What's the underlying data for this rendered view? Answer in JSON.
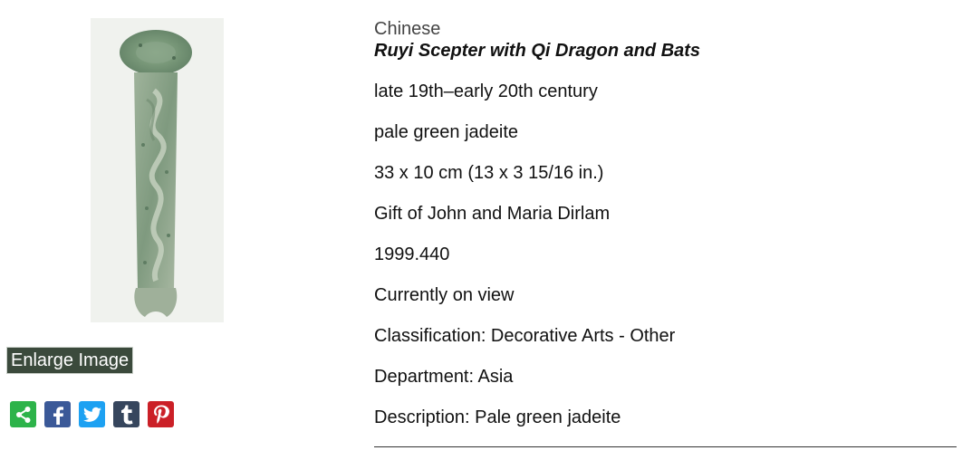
{
  "artwork": {
    "image_alt": "Ruyi Scepter with Qi Dragon and Bats",
    "culture": "Chinese",
    "title": "Ruyi Scepter with Qi Dragon and Bats",
    "date": "late 19th–early 20th century",
    "medium": "pale green jadeite",
    "dimensions": "33 x 10 cm (13 x 3 15/16 in.)",
    "credit": "Gift of John and Maria Dirlam",
    "accession": "1999.440",
    "status": "Currently on view",
    "classification": "Classification: Decorative Arts - Other",
    "department": "Department: Asia",
    "description": "Description: Pale green jadeite"
  },
  "actions": {
    "enlarge_label": "Enlarge Image"
  },
  "share_icons": [
    {
      "name": "share-icon",
      "color": "#2db34a"
    },
    {
      "name": "facebook-icon",
      "color": "#3b5998"
    },
    {
      "name": "twitter-icon",
      "color": "#1da1f2"
    },
    {
      "name": "tumblr-icon",
      "color": "#36465d"
    },
    {
      "name": "pinterest-icon",
      "color": "#cb2027"
    }
  ]
}
